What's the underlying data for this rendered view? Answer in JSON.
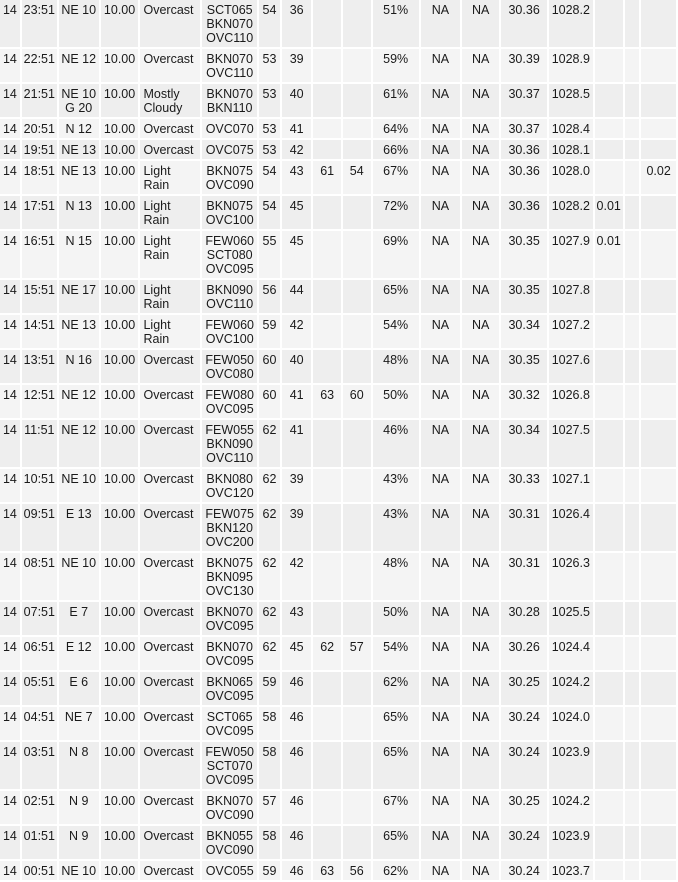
{
  "table": {
    "rows": [
      {
        "day": "14",
        "time": "23:51",
        "wind": [
          "NE 10"
        ],
        "vis": "10.00",
        "weather": [
          "Overcast"
        ],
        "sky": [
          "SCT065",
          "BKN070",
          "OVC110"
        ],
        "temp": "54",
        "dew": "36",
        "max6": "",
        "min6": "",
        "rh": "51%",
        "wind_chill": "NA",
        "heat_index": "NA",
        "altimeter": "30.36",
        "slp": "1028.2",
        "precip_1hr": "",
        "precip_3hr": "",
        "precip_6hr": ""
      },
      {
        "day": "14",
        "time": "22:51",
        "wind": [
          "NE 12"
        ],
        "vis": "10.00",
        "weather": [
          "Overcast"
        ],
        "sky": [
          "BKN070",
          "OVC110"
        ],
        "temp": "53",
        "dew": "39",
        "max6": "",
        "min6": "",
        "rh": "59%",
        "wind_chill": "NA",
        "heat_index": "NA",
        "altimeter": "30.39",
        "slp": "1028.9",
        "precip_1hr": "",
        "precip_3hr": "",
        "precip_6hr": ""
      },
      {
        "day": "14",
        "time": "21:51",
        "wind": [
          "NE 10",
          "G 20"
        ],
        "vis": "10.00",
        "weather": [
          "Mostly",
          "Cloudy"
        ],
        "sky": [
          "BKN070",
          "BKN110"
        ],
        "temp": "53",
        "dew": "40",
        "max6": "",
        "min6": "",
        "rh": "61%",
        "wind_chill": "NA",
        "heat_index": "NA",
        "altimeter": "30.37",
        "slp": "1028.5",
        "precip_1hr": "",
        "precip_3hr": "",
        "precip_6hr": ""
      },
      {
        "day": "14",
        "time": "20:51",
        "wind": [
          "N 12"
        ],
        "vis": "10.00",
        "weather": [
          "Overcast"
        ],
        "sky": [
          "OVC070"
        ],
        "temp": "53",
        "dew": "41",
        "max6": "",
        "min6": "",
        "rh": "64%",
        "wind_chill": "NA",
        "heat_index": "NA",
        "altimeter": "30.37",
        "slp": "1028.4",
        "precip_1hr": "",
        "precip_3hr": "",
        "precip_6hr": ""
      },
      {
        "day": "14",
        "time": "19:51",
        "wind": [
          "NE 13"
        ],
        "vis": "10.00",
        "weather": [
          "Overcast"
        ],
        "sky": [
          "OVC075"
        ],
        "temp": "53",
        "dew": "42",
        "max6": "",
        "min6": "",
        "rh": "66%",
        "wind_chill": "NA",
        "heat_index": "NA",
        "altimeter": "30.36",
        "slp": "1028.1",
        "precip_1hr": "",
        "precip_3hr": "",
        "precip_6hr": ""
      },
      {
        "day": "14",
        "time": "18:51",
        "wind": [
          "NE 13"
        ],
        "vis": "10.00",
        "weather": [
          "Light",
          "Rain"
        ],
        "sky": [
          "BKN075",
          "OVC090"
        ],
        "temp": "54",
        "dew": "43",
        "max6": "61",
        "min6": "54",
        "rh": "67%",
        "wind_chill": "NA",
        "heat_index": "NA",
        "altimeter": "30.36",
        "slp": "1028.0",
        "precip_1hr": "",
        "precip_3hr": "",
        "precip_6hr": "0.02"
      },
      {
        "day": "14",
        "time": "17:51",
        "wind": [
          "N 13"
        ],
        "vis": "10.00",
        "weather": [
          "Light",
          "Rain"
        ],
        "sky": [
          "BKN075",
          "OVC100"
        ],
        "temp": "54",
        "dew": "45",
        "max6": "",
        "min6": "",
        "rh": "72%",
        "wind_chill": "NA",
        "heat_index": "NA",
        "altimeter": "30.36",
        "slp": "1028.2",
        "precip_1hr": "0.01",
        "precip_3hr": "",
        "precip_6hr": ""
      },
      {
        "day": "14",
        "time": "16:51",
        "wind": [
          "N 15"
        ],
        "vis": "10.00",
        "weather": [
          "Light",
          "Rain"
        ],
        "sky": [
          "FEW060",
          "SCT080",
          "OVC095"
        ],
        "temp": "55",
        "dew": "45",
        "max6": "",
        "min6": "",
        "rh": "69%",
        "wind_chill": "NA",
        "heat_index": "NA",
        "altimeter": "30.35",
        "slp": "1027.9",
        "precip_1hr": "0.01",
        "precip_3hr": "",
        "precip_6hr": ""
      },
      {
        "day": "14",
        "time": "15:51",
        "wind": [
          "NE 17"
        ],
        "vis": "10.00",
        "weather": [
          "Light",
          "Rain"
        ],
        "sky": [
          "BKN090",
          "OVC110"
        ],
        "temp": "56",
        "dew": "44",
        "max6": "",
        "min6": "",
        "rh": "65%",
        "wind_chill": "NA",
        "heat_index": "NA",
        "altimeter": "30.35",
        "slp": "1027.8",
        "precip_1hr": "",
        "precip_3hr": "",
        "precip_6hr": ""
      },
      {
        "day": "14",
        "time": "14:51",
        "wind": [
          "NE 13"
        ],
        "vis": "10.00",
        "weather": [
          "Light",
          "Rain"
        ],
        "sky": [
          "FEW060",
          "OVC100"
        ],
        "temp": "59",
        "dew": "42",
        "max6": "",
        "min6": "",
        "rh": "54%",
        "wind_chill": "NA",
        "heat_index": "NA",
        "altimeter": "30.34",
        "slp": "1027.2",
        "precip_1hr": "",
        "precip_3hr": "",
        "precip_6hr": ""
      },
      {
        "day": "14",
        "time": "13:51",
        "wind": [
          "N 16"
        ],
        "vis": "10.00",
        "weather": [
          "Overcast"
        ],
        "sky": [
          "FEW050",
          "OVC080"
        ],
        "temp": "60",
        "dew": "40",
        "max6": "",
        "min6": "",
        "rh": "48%",
        "wind_chill": "NA",
        "heat_index": "NA",
        "altimeter": "30.35",
        "slp": "1027.6",
        "precip_1hr": "",
        "precip_3hr": "",
        "precip_6hr": ""
      },
      {
        "day": "14",
        "time": "12:51",
        "wind": [
          "NE 12"
        ],
        "vis": "10.00",
        "weather": [
          "Overcast"
        ],
        "sky": [
          "FEW080",
          "OVC095"
        ],
        "temp": "60",
        "dew": "41",
        "max6": "63",
        "min6": "60",
        "rh": "50%",
        "wind_chill": "NA",
        "heat_index": "NA",
        "altimeter": "30.32",
        "slp": "1026.8",
        "precip_1hr": "",
        "precip_3hr": "",
        "precip_6hr": ""
      },
      {
        "day": "14",
        "time": "11:51",
        "wind": [
          "NE 12"
        ],
        "vis": "10.00",
        "weather": [
          "Overcast"
        ],
        "sky": [
          "FEW055",
          "BKN090",
          "OVC110"
        ],
        "temp": "62",
        "dew": "41",
        "max6": "",
        "min6": "",
        "rh": "46%",
        "wind_chill": "NA",
        "heat_index": "NA",
        "altimeter": "30.34",
        "slp": "1027.5",
        "precip_1hr": "",
        "precip_3hr": "",
        "precip_6hr": ""
      },
      {
        "day": "14",
        "time": "10:51",
        "wind": [
          "NE 10"
        ],
        "vis": "10.00",
        "weather": [
          "Overcast"
        ],
        "sky": [
          "BKN080",
          "OVC120"
        ],
        "temp": "62",
        "dew": "39",
        "max6": "",
        "min6": "",
        "rh": "43%",
        "wind_chill": "NA",
        "heat_index": "NA",
        "altimeter": "30.33",
        "slp": "1027.1",
        "precip_1hr": "",
        "precip_3hr": "",
        "precip_6hr": ""
      },
      {
        "day": "14",
        "time": "09:51",
        "wind": [
          "E 13"
        ],
        "vis": "10.00",
        "weather": [
          "Overcast"
        ],
        "sky": [
          "FEW075",
          "BKN120",
          "OVC200"
        ],
        "temp": "62",
        "dew": "39",
        "max6": "",
        "min6": "",
        "rh": "43%",
        "wind_chill": "NA",
        "heat_index": "NA",
        "altimeter": "30.31",
        "slp": "1026.4",
        "precip_1hr": "",
        "precip_3hr": "",
        "precip_6hr": ""
      },
      {
        "day": "14",
        "time": "08:51",
        "wind": [
          "NE 10"
        ],
        "vis": "10.00",
        "weather": [
          "Overcast"
        ],
        "sky": [
          "BKN075",
          "BKN095",
          "OVC130"
        ],
        "temp": "62",
        "dew": "42",
        "max6": "",
        "min6": "",
        "rh": "48%",
        "wind_chill": "NA",
        "heat_index": "NA",
        "altimeter": "30.31",
        "slp": "1026.3",
        "precip_1hr": "",
        "precip_3hr": "",
        "precip_6hr": ""
      },
      {
        "day": "14",
        "time": "07:51",
        "wind": [
          "E 7"
        ],
        "vis": "10.00",
        "weather": [
          "Overcast"
        ],
        "sky": [
          "BKN070",
          "OVC095"
        ],
        "temp": "62",
        "dew": "43",
        "max6": "",
        "min6": "",
        "rh": "50%",
        "wind_chill": "NA",
        "heat_index": "NA",
        "altimeter": "30.28",
        "slp": "1025.5",
        "precip_1hr": "",
        "precip_3hr": "",
        "precip_6hr": ""
      },
      {
        "day": "14",
        "time": "06:51",
        "wind": [
          "E 12"
        ],
        "vis": "10.00",
        "weather": [
          "Overcast"
        ],
        "sky": [
          "BKN070",
          "OVC095"
        ],
        "temp": "62",
        "dew": "45",
        "max6": "62",
        "min6": "57",
        "rh": "54%",
        "wind_chill": "NA",
        "heat_index": "NA",
        "altimeter": "30.26",
        "slp": "1024.4",
        "precip_1hr": "",
        "precip_3hr": "",
        "precip_6hr": ""
      },
      {
        "day": "14",
        "time": "05:51",
        "wind": [
          "E 6"
        ],
        "vis": "10.00",
        "weather": [
          "Overcast"
        ],
        "sky": [
          "BKN065",
          "OVC095"
        ],
        "temp": "59",
        "dew": "46",
        "max6": "",
        "min6": "",
        "rh": "62%",
        "wind_chill": "NA",
        "heat_index": "NA",
        "altimeter": "30.25",
        "slp": "1024.2",
        "precip_1hr": "",
        "precip_3hr": "",
        "precip_6hr": ""
      },
      {
        "day": "14",
        "time": "04:51",
        "wind": [
          "NE 7"
        ],
        "vis": "10.00",
        "weather": [
          "Overcast"
        ],
        "sky": [
          "SCT065",
          "OVC095"
        ],
        "temp": "58",
        "dew": "46",
        "max6": "",
        "min6": "",
        "rh": "65%",
        "wind_chill": "NA",
        "heat_index": "NA",
        "altimeter": "30.24",
        "slp": "1024.0",
        "precip_1hr": "",
        "precip_3hr": "",
        "precip_6hr": ""
      },
      {
        "day": "14",
        "time": "03:51",
        "wind": [
          "N 8"
        ],
        "vis": "10.00",
        "weather": [
          "Overcast"
        ],
        "sky": [
          "FEW050",
          "SCT070",
          "OVC095"
        ],
        "temp": "58",
        "dew": "46",
        "max6": "",
        "min6": "",
        "rh": "65%",
        "wind_chill": "NA",
        "heat_index": "NA",
        "altimeter": "30.24",
        "slp": "1023.9",
        "precip_1hr": "",
        "precip_3hr": "",
        "precip_6hr": ""
      },
      {
        "day": "14",
        "time": "02:51",
        "wind": [
          "N 9"
        ],
        "vis": "10.00",
        "weather": [
          "Overcast"
        ],
        "sky": [
          "BKN070",
          "OVC090"
        ],
        "temp": "57",
        "dew": "46",
        "max6": "",
        "min6": "",
        "rh": "67%",
        "wind_chill": "NA",
        "heat_index": "NA",
        "altimeter": "30.25",
        "slp": "1024.2",
        "precip_1hr": "",
        "precip_3hr": "",
        "precip_6hr": ""
      },
      {
        "day": "14",
        "time": "01:51",
        "wind": [
          "N 9"
        ],
        "vis": "10.00",
        "weather": [
          "Overcast"
        ],
        "sky": [
          "BKN055",
          "OVC090"
        ],
        "temp": "58",
        "dew": "46",
        "max6": "",
        "min6": "",
        "rh": "65%",
        "wind_chill": "NA",
        "heat_index": "NA",
        "altimeter": "30.24",
        "slp": "1023.9",
        "precip_1hr": "",
        "precip_3hr": "",
        "precip_6hr": ""
      },
      {
        "day": "14",
        "time": "00:51",
        "wind": [
          "NE 10"
        ],
        "vis": "10.00",
        "weather": [
          "Overcast"
        ],
        "sky": [
          "OVC055"
        ],
        "temp": "59",
        "dew": "46",
        "max6": "63",
        "min6": "56",
        "rh": "62%",
        "wind_chill": "NA",
        "heat_index": "NA",
        "altimeter": "30.24",
        "slp": "1023.7",
        "precip_1hr": "",
        "precip_3hr": "",
        "precip_6hr": ""
      }
    ]
  }
}
